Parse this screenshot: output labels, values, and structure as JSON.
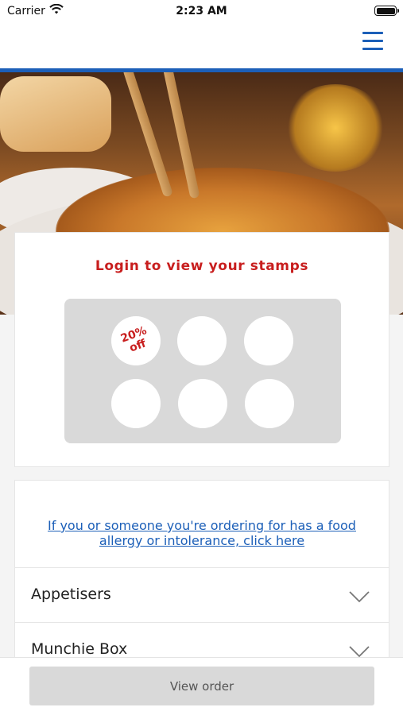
{
  "status_bar": {
    "carrier": "Carrier",
    "time": "2:23 AM"
  },
  "nav": {
    "menu_icon": "hamburger-menu-icon",
    "accent_color": "#1c5fb8"
  },
  "stamp_card": {
    "title": "Login to view your stamps",
    "reward_text": "20%\noff",
    "stamps_total": 6,
    "title_color": "#c81e1e"
  },
  "menu": {
    "allergy_link": "If you or someone you're ordering for has a food allergy or intolerance, click here",
    "categories": [
      {
        "label": "Appetisers",
        "icon": "chevron-down-icon"
      },
      {
        "label": "Munchie Box",
        "icon": "chevron-down-icon"
      }
    ]
  },
  "footer": {
    "view_order_label": "View order"
  }
}
